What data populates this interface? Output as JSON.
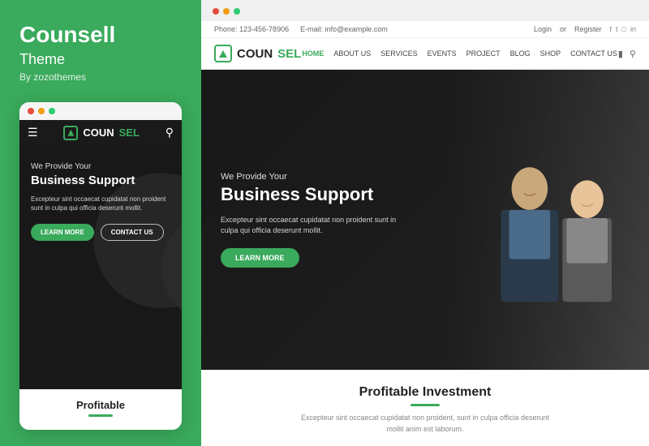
{
  "left": {
    "title": "Counsell",
    "subtitle": "Theme",
    "author": "By zozothemes",
    "mobile": {
      "dots": [
        "red",
        "yellow",
        "green"
      ],
      "nav": {
        "logo_prefix": "COUN",
        "logo_suffix": "SEL"
      },
      "hero": {
        "tagline": "We Provide Your",
        "title": "Business Support",
        "description": "Excepteur sint occaecat cupidatat\nnon proident sunt in culpa qui\nofficia deserunt mollit.",
        "btn_learn": "LEARN MORE",
        "btn_contact": "CONTACT US"
      },
      "profitable": {
        "title": "Profitable"
      }
    }
  },
  "right": {
    "browser_dots": [
      "red",
      "yellow",
      "green"
    ],
    "topbar": {
      "phone": "Phone: 123-456-78906",
      "email": "E-mail: info@example.com",
      "login": "Login",
      "or": "or",
      "register": "Register",
      "socials": [
        "f",
        "t",
        "in",
        "in"
      ]
    },
    "nav": {
      "logo_prefix": "COUN",
      "logo_suffix": "SEL",
      "menu": [
        "HOME",
        "ABOUT US",
        "SERVICES",
        "EVENTS",
        "PROJECT",
        "BLOG",
        "SHOP",
        "CONTACT US"
      ],
      "active_index": 0
    },
    "hero": {
      "tagline": "We Provide Your",
      "title": "Business Support",
      "description": "Excepteur sint occaecat cupidatat non proident sunt in\nculpa qui officia deserunt mollit.",
      "btn_learn": "LEARN MORE"
    },
    "bottom": {
      "title": "Profitable Investment",
      "description": "Excepteur sint occaecat cupidatat non proident, sunt in culpa officia\ndeserunt mollit anim est laborum."
    }
  }
}
